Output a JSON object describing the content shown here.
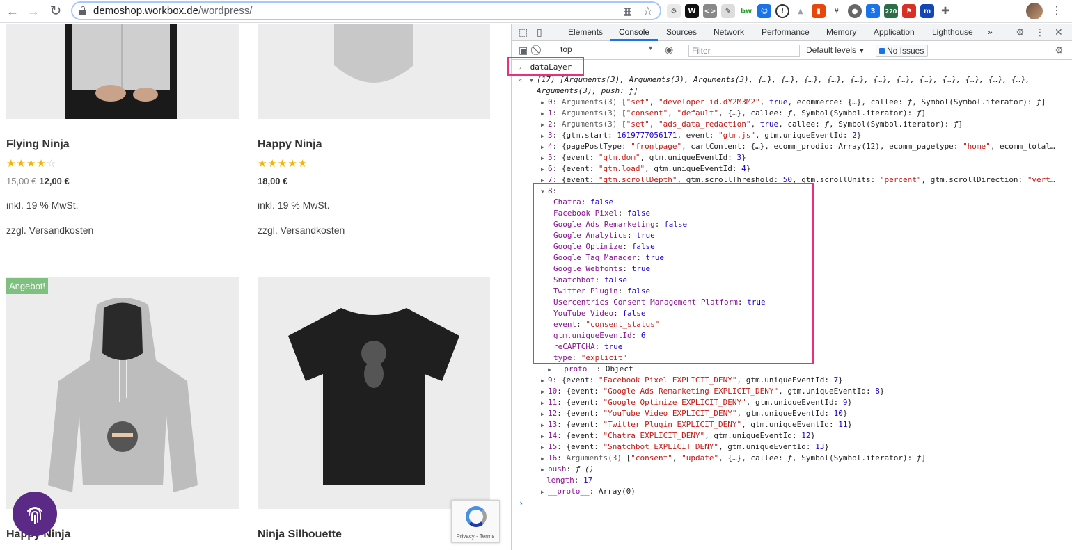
{
  "browser": {
    "url_host": "demoshop.workbox.de",
    "url_path": "/wordpress/"
  },
  "shop": {
    "products": [
      {
        "title": "Flying Ninja",
        "rating": 4,
        "old_price": "15,00 €",
        "price": "12,00 €",
        "tax": "inkl. 19 % MwSt.",
        "shipping": "zzgl. Versandkosten"
      },
      {
        "title": "Happy Ninja",
        "rating": 5,
        "old_price": "",
        "price": "18,00 €",
        "tax": "inkl. 19 % MwSt.",
        "shipping": "zzgl. Versandkosten"
      },
      {
        "title": "Happy Ninja",
        "badge": "Angebot!"
      },
      {
        "title": "Ninja Silhouette"
      }
    ],
    "recaptcha_text": "Privacy - Terms"
  },
  "devtools": {
    "tabs": [
      "Elements",
      "Console",
      "Sources",
      "Network",
      "Performance",
      "Memory",
      "Application",
      "Lighthouse"
    ],
    "active_tab": "Console",
    "more_tabs": "»",
    "context": "top",
    "filter_placeholder": "Filter",
    "levels": "Default levels",
    "issues": "No Issues",
    "input_command": "dataLayer"
  },
  "console_lines": [
    {
      "html": "<span class='tri'>&lt;</span>"
    },
    {
      "html": "<span class='tri'>▼</span><span class='i'>(17) [Arguments(3), Arguments(3), Arguments(3), {…}, {…}, {…}, {…}, {…}, {…}, {…}, {…}, {…}, {…}, {…}, {…},</span>"
    },
    {
      "html": "<span class='i'>Arguments(3), push: ƒ]</span>"
    },
    {
      "html": "<span class='tri'>▶</span><span class='k'>0</span>: <span class='g'>Arguments(3)</span> [<span class='s'>\"set\"</span>, <span class='s'>\"developer_id.dY2M3M2\"</span>, <span class='n'>true</span>, ecommerce: {…}, callee: <span class='i'>ƒ</span>, Symbol(Symbol.iterator): <span class='i'>ƒ</span>]"
    },
    {
      "html": "<span class='tri'>▶</span><span class='k'>1</span>: <span class='g'>Arguments(3)</span> [<span class='s'>\"consent\"</span>, <span class='s'>\"default\"</span>, {…}, callee: <span class='i'>ƒ</span>, Symbol(Symbol.iterator): <span class='i'>ƒ</span>]"
    },
    {
      "html": "<span class='tri'>▶</span><span class='k'>2</span>: <span class='g'>Arguments(3)</span> [<span class='s'>\"set\"</span>, <span class='s'>\"ads_data_redaction\"</span>, <span class='n'>true</span>, callee: <span class='i'>ƒ</span>, Symbol(Symbol.iterator): <span class='i'>ƒ</span>]"
    },
    {
      "html": "<span class='tri'>▶</span><span class='k'>3</span>: {gtm.start: <span class='n'>1619777056171</span>, event: <span class='s'>\"gtm.js\"</span>, gtm.uniqueEventId: <span class='n'>2</span>}"
    },
    {
      "html": "<span class='tri'>▶</span><span class='k'>4</span>: {pagePostType: <span class='s'>\"frontpage\"</span>, cartContent: {…}, ecomm_prodid: Array(12), ecomm_pagetype: <span class='s'>\"home\"</span>, ecomm_total…"
    },
    {
      "html": "<span class='tri'>▶</span><span class='k'>5</span>: {event: <span class='s'>\"gtm.dom\"</span>, gtm.uniqueEventId: <span class='n'>3</span>}"
    },
    {
      "html": "<span class='tri'>▶</span><span class='k'>6</span>: {event: <span class='s'>\"gtm.load\"</span>, gtm.uniqueEventId: <span class='n'>4</span>}"
    },
    {
      "html": "<span class='tri'>▶</span><span class='k'>7</span>: {event: <span class='s'>\"gtm.scrollDepth\"</span>, gtm.scrollThreshold: <span class='n'>50</span>, gtm.scrollUnits: <span class='s'>\"percent\"</span>, gtm.scrollDirection: <span class='s'>\"vert…</span>"
    },
    {
      "html": "<span class='tri'>▼</span><span class='k'>8</span>:"
    },
    {
      "html": "<span class='k'>Chatra</span>: <span class='n'>false</span>"
    },
    {
      "html": "<span class='k'>Facebook Pixel</span>: <span class='n'>false</span>"
    },
    {
      "html": "<span class='k'>Google Ads Remarketing</span>: <span class='n'>false</span>"
    },
    {
      "html": "<span class='k'>Google Analytics</span>: <span class='n'>true</span>"
    },
    {
      "html": "<span class='k'>Google Optimize</span>: <span class='n'>false</span>"
    },
    {
      "html": "<span class='k'>Google Tag Manager</span>: <span class='n'>true</span>"
    },
    {
      "html": "<span class='k'>Google Webfonts</span>: <span class='n'>true</span>"
    },
    {
      "html": "<span class='k'>Snatchbot</span>: <span class='n'>false</span>"
    },
    {
      "html": "<span class='k'>Twitter Plugin</span>: <span class='n'>false</span>"
    },
    {
      "html": "<span class='k'>Usercentrics Consent Management Platform</span>: <span class='n'>true</span>"
    },
    {
      "html": "<span class='k'>YouTube Video</span>: <span class='n'>false</span>"
    },
    {
      "html": "<span class='k'>event</span>: <span class='s'>\"consent_status\"</span>"
    },
    {
      "html": "<span class='k'>gtm.uniqueEventId</span>: <span class='n'>6</span>"
    },
    {
      "html": "<span class='k'>reCAPTCHA</span>: <span class='n'>true</span>"
    },
    {
      "html": "<span class='k'>type</span>: <span class='s'>\"explicit\"</span>"
    },
    {
      "html": "<span class='tri'>▶</span><span class='k'>__proto__</span>: Object"
    },
    {
      "html": "<span class='tri'>▶</span><span class='k'>9</span>: {event: <span class='s'>\"Facebook Pixel EXPLICIT_DENY\"</span>, gtm.uniqueEventId: <span class='n'>7</span>}"
    },
    {
      "html": "<span class='tri'>▶</span><span class='k'>10</span>: {event: <span class='s'>\"Google Ads Remarketing EXPLICIT_DENY\"</span>, gtm.uniqueEventId: <span class='n'>8</span>}"
    },
    {
      "html": "<span class='tri'>▶</span><span class='k'>11</span>: {event: <span class='s'>\"Google Optimize EXPLICIT_DENY\"</span>, gtm.uniqueEventId: <span class='n'>9</span>}"
    },
    {
      "html": "<span class='tri'>▶</span><span class='k'>12</span>: {event: <span class='s'>\"YouTube Video EXPLICIT_DENY\"</span>, gtm.uniqueEventId: <span class='n'>10</span>}"
    },
    {
      "html": "<span class='tri'>▶</span><span class='k'>13</span>: {event: <span class='s'>\"Twitter Plugin EXPLICIT_DENY\"</span>, gtm.uniqueEventId: <span class='n'>11</span>}"
    },
    {
      "html": "<span class='tri'>▶</span><span class='k'>14</span>: {event: <span class='s'>\"Chatra EXPLICIT_DENY\"</span>, gtm.uniqueEventId: <span class='n'>12</span>}"
    },
    {
      "html": "<span class='tri'>▶</span><span class='k'>15</span>: {event: <span class='s'>\"Snatchbot EXPLICIT_DENY\"</span>, gtm.uniqueEventId: <span class='n'>13</span>}"
    },
    {
      "html": "<span class='tri'>▶</span><span class='k'>16</span>: <span class='g'>Arguments(3)</span> [<span class='s'>\"consent\"</span>, <span class='s'>\"update\"</span>, {…}, callee: <span class='i'>ƒ</span>, Symbol(Symbol.iterator): <span class='i'>ƒ</span>]"
    },
    {
      "html": "<span class='tri'>▶</span><span class='k'>push</span>: <span class='i'>ƒ ()</span>"
    },
    {
      "html": "<span class='k'>length</span>: <span class='n'>17</span>"
    },
    {
      "html": "<span class='tri'>▶</span><span class='k'>__proto__</span>: Array(0)"
    }
  ]
}
